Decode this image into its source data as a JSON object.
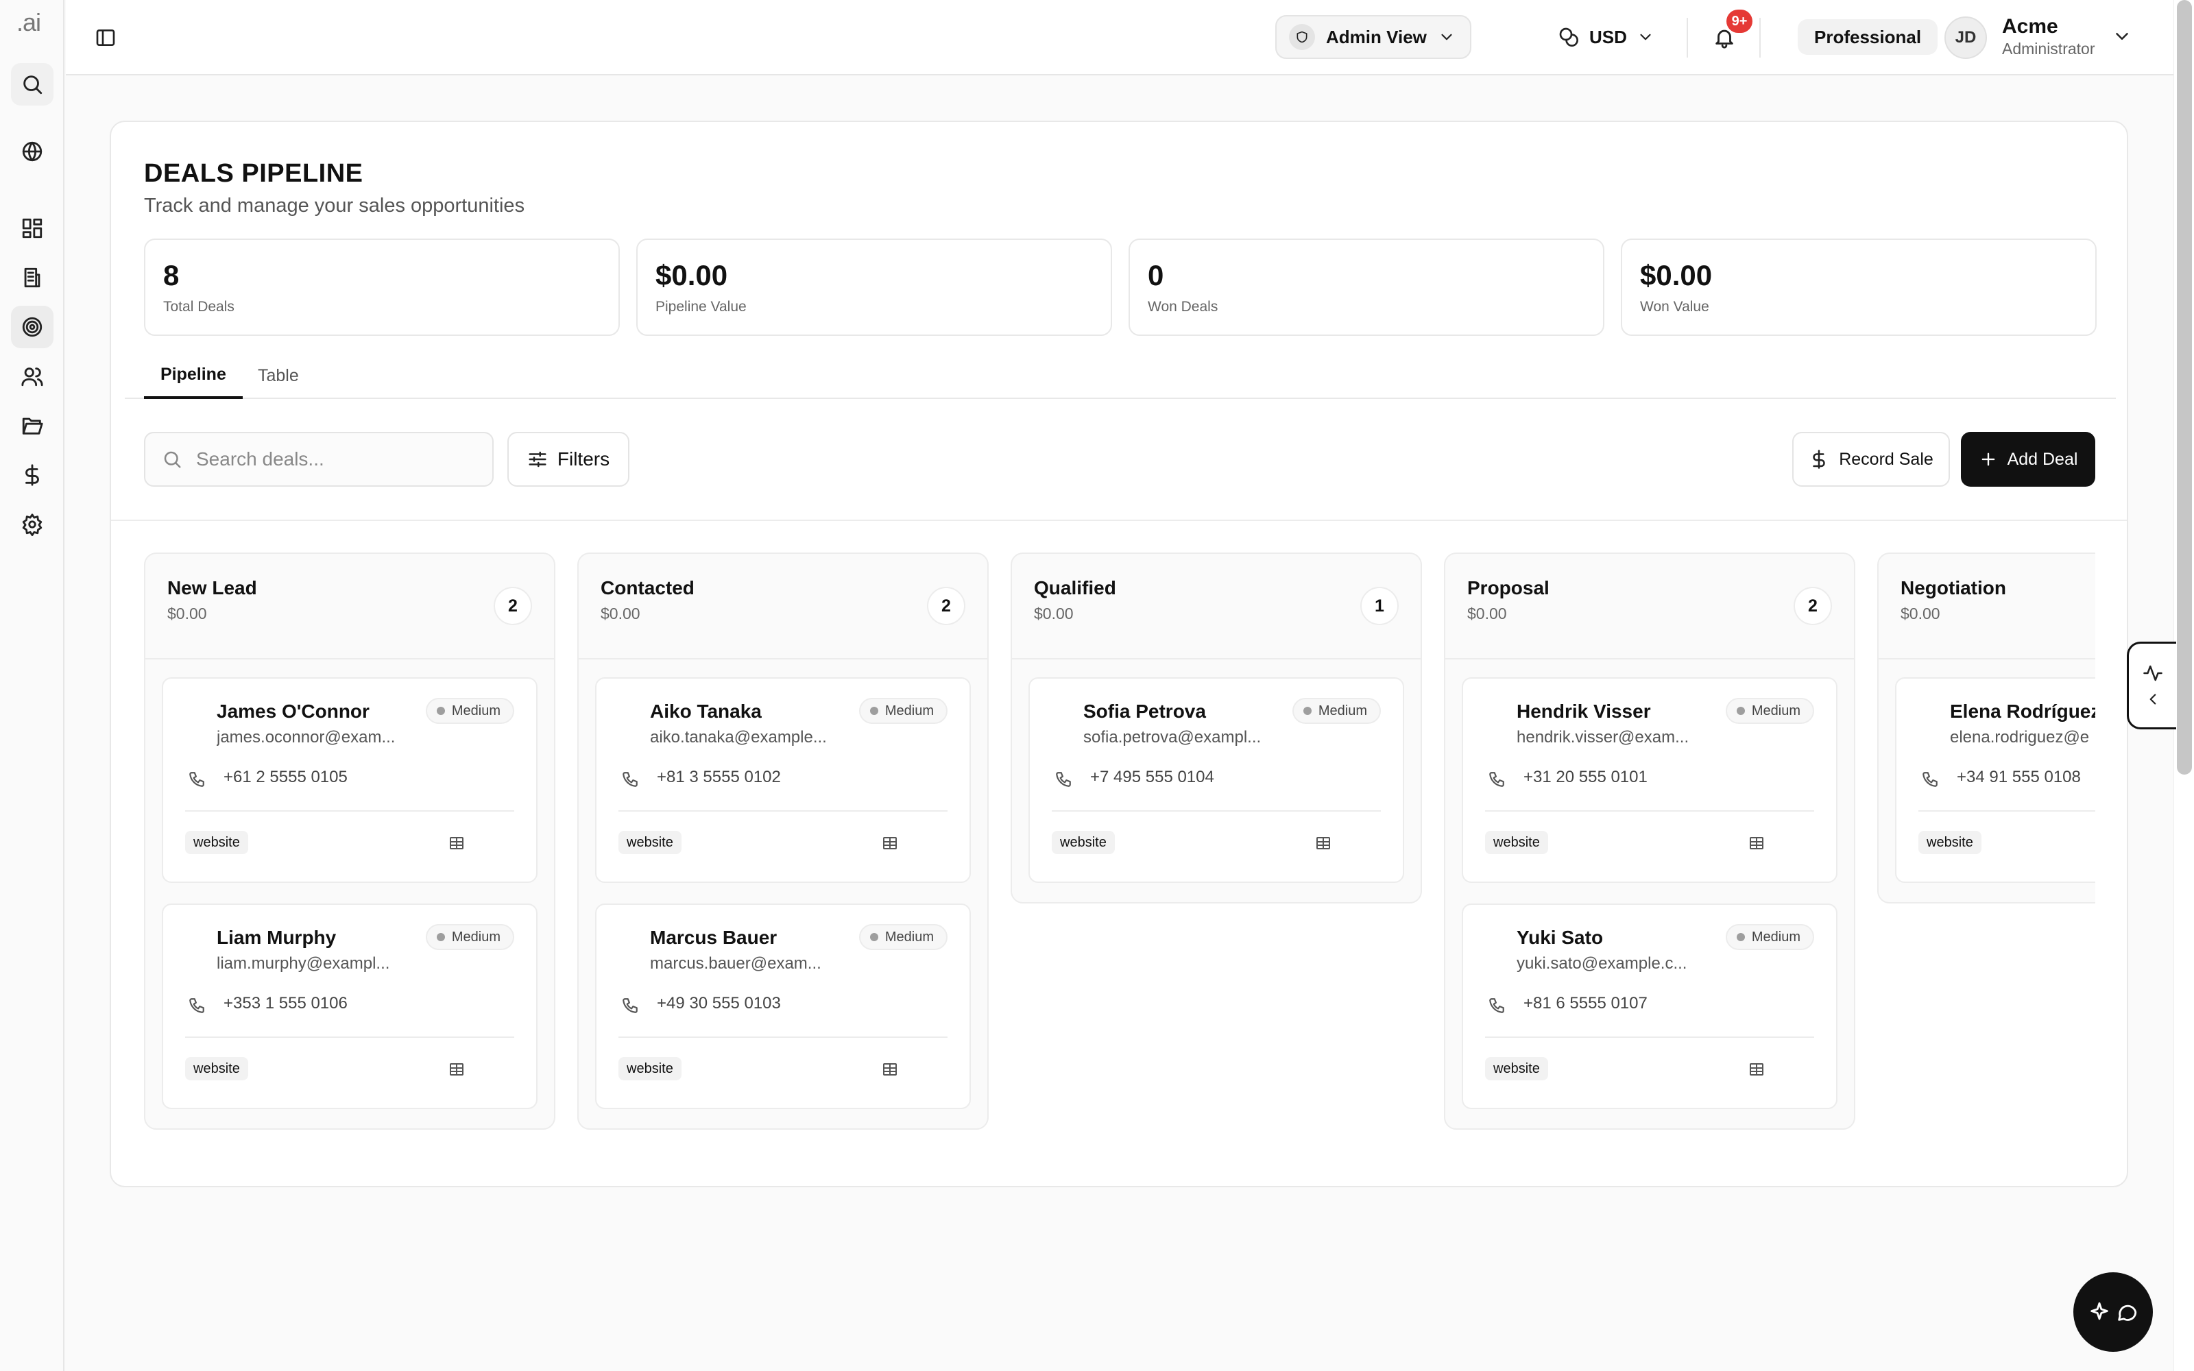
{
  "app": {
    "logo": ".ai"
  },
  "topbar": {
    "view_label": "Admin View",
    "currency": "USD",
    "notification_count": "9+",
    "plan": "Professional",
    "user": {
      "initials": "JD",
      "name": "Acme",
      "role": "Administrator"
    }
  },
  "page": {
    "title": "DEALS PIPELINE",
    "subtitle": "Track and manage your sales opportunities"
  },
  "stats": [
    {
      "value": "8",
      "label": "Total Deals"
    },
    {
      "value": "$0.00",
      "label": "Pipeline Value"
    },
    {
      "value": "0",
      "label": "Won Deals"
    },
    {
      "value": "$0.00",
      "label": "Won Value"
    }
  ],
  "tabs": [
    {
      "label": "Pipeline"
    },
    {
      "label": "Table"
    }
  ],
  "toolbar": {
    "search_placeholder": "Search deals...",
    "filters_label": "Filters",
    "record_sale_label": "Record Sale",
    "add_deal_label": "Add Deal"
  },
  "columns": [
    {
      "title": "New Lead",
      "total": "$0.00",
      "count": "2",
      "deals": [
        {
          "name": "James O'Connor",
          "email": "james.oconnor@exam...",
          "phone": "+61 2 5555 0105",
          "priority": "Medium",
          "source": "website"
        },
        {
          "name": "Liam Murphy",
          "email": "liam.murphy@exampl...",
          "phone": "+353 1 555 0106",
          "priority": "Medium",
          "source": "website"
        }
      ]
    },
    {
      "title": "Contacted",
      "total": "$0.00",
      "count": "2",
      "deals": [
        {
          "name": "Aiko Tanaka",
          "email": "aiko.tanaka@example...",
          "phone": "+81 3 5555 0102",
          "priority": "Medium",
          "source": "website"
        },
        {
          "name": "Marcus Bauer",
          "email": "marcus.bauer@exam...",
          "phone": "+49 30 555 0103",
          "priority": "Medium",
          "source": "website"
        }
      ]
    },
    {
      "title": "Qualified",
      "total": "$0.00",
      "count": "1",
      "deals": [
        {
          "name": "Sofia Petrova",
          "email": "sofia.petrova@exampl...",
          "phone": "+7 495 555 0104",
          "priority": "Medium",
          "source": "website"
        }
      ]
    },
    {
      "title": "Proposal",
      "total": "$0.00",
      "count": "2",
      "deals": [
        {
          "name": "Hendrik Visser",
          "email": "hendrik.visser@exam...",
          "phone": "+31 20 555 0101",
          "priority": "Medium",
          "source": "website"
        },
        {
          "name": "Yuki Sato",
          "email": "yuki.sato@example.c...",
          "phone": "+81 6 5555 0107",
          "priority": "Medium",
          "source": "website"
        }
      ]
    },
    {
      "title": "Negotiation",
      "total": "$0.00",
      "count": "",
      "deals": [
        {
          "name": "Elena Rodríguez",
          "email": "elena.rodriguez@e",
          "phone": "+34 91 555 0108",
          "priority": "",
          "source": "website"
        }
      ]
    }
  ]
}
